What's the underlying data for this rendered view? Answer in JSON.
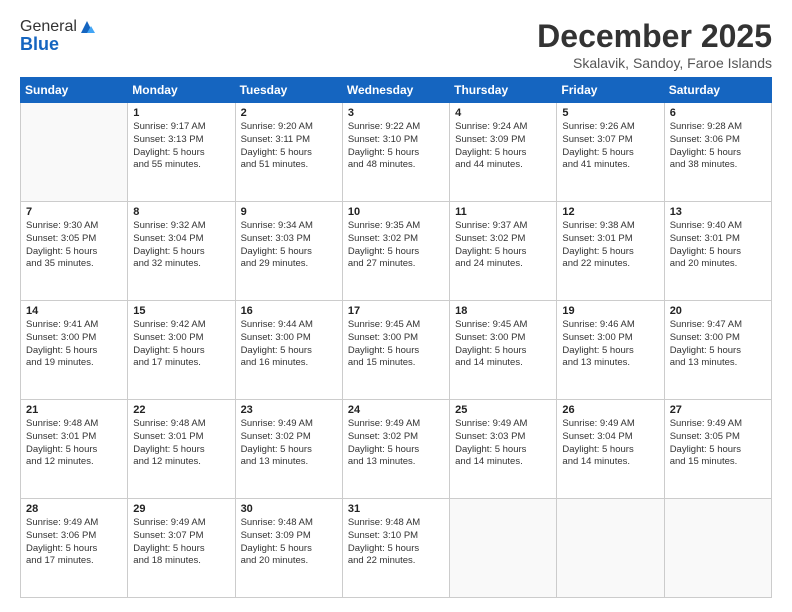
{
  "header": {
    "logo_general": "General",
    "logo_blue": "Blue",
    "title": "December 2025",
    "location": "Skalavik, Sandoy, Faroe Islands"
  },
  "days_of_week": [
    "Sunday",
    "Monday",
    "Tuesday",
    "Wednesday",
    "Thursday",
    "Friday",
    "Saturday"
  ],
  "weeks": [
    [
      {
        "day": "",
        "info": ""
      },
      {
        "day": "1",
        "info": "Sunrise: 9:17 AM\nSunset: 3:13 PM\nDaylight: 5 hours\nand 55 minutes."
      },
      {
        "day": "2",
        "info": "Sunrise: 9:20 AM\nSunset: 3:11 PM\nDaylight: 5 hours\nand 51 minutes."
      },
      {
        "day": "3",
        "info": "Sunrise: 9:22 AM\nSunset: 3:10 PM\nDaylight: 5 hours\nand 48 minutes."
      },
      {
        "day": "4",
        "info": "Sunrise: 9:24 AM\nSunset: 3:09 PM\nDaylight: 5 hours\nand 44 minutes."
      },
      {
        "day": "5",
        "info": "Sunrise: 9:26 AM\nSunset: 3:07 PM\nDaylight: 5 hours\nand 41 minutes."
      },
      {
        "day": "6",
        "info": "Sunrise: 9:28 AM\nSunset: 3:06 PM\nDaylight: 5 hours\nand 38 minutes."
      }
    ],
    [
      {
        "day": "7",
        "info": "Sunrise: 9:30 AM\nSunset: 3:05 PM\nDaylight: 5 hours\nand 35 minutes."
      },
      {
        "day": "8",
        "info": "Sunrise: 9:32 AM\nSunset: 3:04 PM\nDaylight: 5 hours\nand 32 minutes."
      },
      {
        "day": "9",
        "info": "Sunrise: 9:34 AM\nSunset: 3:03 PM\nDaylight: 5 hours\nand 29 minutes."
      },
      {
        "day": "10",
        "info": "Sunrise: 9:35 AM\nSunset: 3:02 PM\nDaylight: 5 hours\nand 27 minutes."
      },
      {
        "day": "11",
        "info": "Sunrise: 9:37 AM\nSunset: 3:02 PM\nDaylight: 5 hours\nand 24 minutes."
      },
      {
        "day": "12",
        "info": "Sunrise: 9:38 AM\nSunset: 3:01 PM\nDaylight: 5 hours\nand 22 minutes."
      },
      {
        "day": "13",
        "info": "Sunrise: 9:40 AM\nSunset: 3:01 PM\nDaylight: 5 hours\nand 20 minutes."
      }
    ],
    [
      {
        "day": "14",
        "info": "Sunrise: 9:41 AM\nSunset: 3:00 PM\nDaylight: 5 hours\nand 19 minutes."
      },
      {
        "day": "15",
        "info": "Sunrise: 9:42 AM\nSunset: 3:00 PM\nDaylight: 5 hours\nand 17 minutes."
      },
      {
        "day": "16",
        "info": "Sunrise: 9:44 AM\nSunset: 3:00 PM\nDaylight: 5 hours\nand 16 minutes."
      },
      {
        "day": "17",
        "info": "Sunrise: 9:45 AM\nSunset: 3:00 PM\nDaylight: 5 hours\nand 15 minutes."
      },
      {
        "day": "18",
        "info": "Sunrise: 9:45 AM\nSunset: 3:00 PM\nDaylight: 5 hours\nand 14 minutes."
      },
      {
        "day": "19",
        "info": "Sunrise: 9:46 AM\nSunset: 3:00 PM\nDaylight: 5 hours\nand 13 minutes."
      },
      {
        "day": "20",
        "info": "Sunrise: 9:47 AM\nSunset: 3:00 PM\nDaylight: 5 hours\nand 13 minutes."
      }
    ],
    [
      {
        "day": "21",
        "info": "Sunrise: 9:48 AM\nSunset: 3:01 PM\nDaylight: 5 hours\nand 12 minutes."
      },
      {
        "day": "22",
        "info": "Sunrise: 9:48 AM\nSunset: 3:01 PM\nDaylight: 5 hours\nand 12 minutes."
      },
      {
        "day": "23",
        "info": "Sunrise: 9:49 AM\nSunset: 3:02 PM\nDaylight: 5 hours\nand 13 minutes."
      },
      {
        "day": "24",
        "info": "Sunrise: 9:49 AM\nSunset: 3:02 PM\nDaylight: 5 hours\nand 13 minutes."
      },
      {
        "day": "25",
        "info": "Sunrise: 9:49 AM\nSunset: 3:03 PM\nDaylight: 5 hours\nand 14 minutes."
      },
      {
        "day": "26",
        "info": "Sunrise: 9:49 AM\nSunset: 3:04 PM\nDaylight: 5 hours\nand 14 minutes."
      },
      {
        "day": "27",
        "info": "Sunrise: 9:49 AM\nSunset: 3:05 PM\nDaylight: 5 hours\nand 15 minutes."
      }
    ],
    [
      {
        "day": "28",
        "info": "Sunrise: 9:49 AM\nSunset: 3:06 PM\nDaylight: 5 hours\nand 17 minutes."
      },
      {
        "day": "29",
        "info": "Sunrise: 9:49 AM\nSunset: 3:07 PM\nDaylight: 5 hours\nand 18 minutes."
      },
      {
        "day": "30",
        "info": "Sunrise: 9:48 AM\nSunset: 3:09 PM\nDaylight: 5 hours\nand 20 minutes."
      },
      {
        "day": "31",
        "info": "Sunrise: 9:48 AM\nSunset: 3:10 PM\nDaylight: 5 hours\nand 22 minutes."
      },
      {
        "day": "",
        "info": ""
      },
      {
        "day": "",
        "info": ""
      },
      {
        "day": "",
        "info": ""
      }
    ]
  ]
}
